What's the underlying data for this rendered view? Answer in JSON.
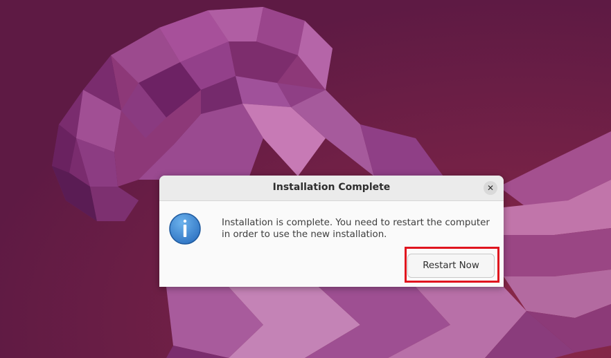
{
  "desktop": {
    "background_color": "#6a1b45",
    "wallpaper": "ubuntu-jammy-jellyfish-wallpaper"
  },
  "dialog": {
    "title": "Installation Complete",
    "close_icon": "close-icon",
    "info_icon": "info-icon",
    "message": "Installation is complete. You need to restart the computer in order to use the new installation.",
    "restart_label": "Restart Now"
  },
  "highlight": {
    "color": "#e0141e",
    "target": "restart-now-button"
  }
}
